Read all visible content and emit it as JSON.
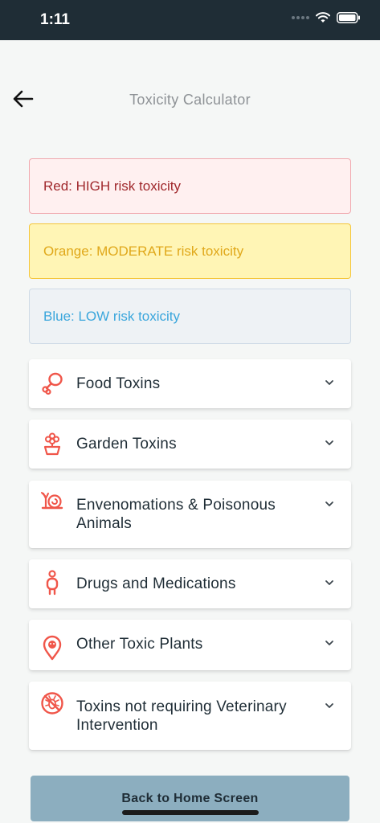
{
  "status_bar": {
    "time": "1:11"
  },
  "header": {
    "title": "Toxicity  Calculator"
  },
  "legend": {
    "red": "Red: HIGH risk toxicity",
    "orange": "Orange: MODERATE risk toxicity",
    "blue": "Blue: LOW risk toxicity"
  },
  "categories": [
    {
      "label": "Food Toxins",
      "icon": "food-icon"
    },
    {
      "label": "Garden Toxins",
      "icon": "flower-pot-icon"
    },
    {
      "label": "Envenomations & Poisonous Animals",
      "icon": "snail-icon"
    },
    {
      "label": "Drugs and Medications",
      "icon": "person-icon"
    },
    {
      "label": "Other Toxic Plants",
      "icon": "location-pin-icon"
    },
    {
      "label": "Toxins not requiring Veterinary Intervention",
      "icon": "no-insect-icon"
    }
  ],
  "footer": {
    "home_button": "Back to Home Screen"
  },
  "colors": {
    "accent_icon": "#f0564a",
    "high": "#a0282c",
    "moderate": "#e0a81a",
    "low": "#3aa6dc",
    "button": "#8caebf",
    "status_bar": "#1f2d36"
  }
}
